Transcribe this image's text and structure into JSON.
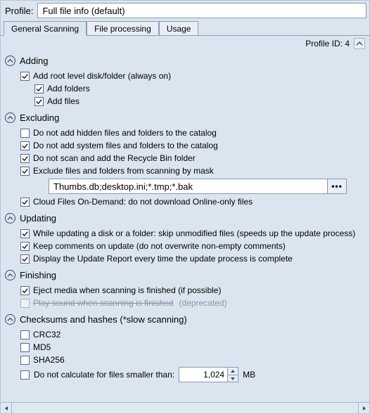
{
  "profile": {
    "label": "Profile:",
    "value": "Full file info (default)"
  },
  "tabs": [
    {
      "label": "General Scanning",
      "active": true
    },
    {
      "label": "File processing",
      "active": false
    },
    {
      "label": "Usage",
      "active": false
    }
  ],
  "meta": {
    "profile_id_label": "Profile ID: 4"
  },
  "sections": {
    "adding": {
      "title": "Adding",
      "items": {
        "root": "Add root level disk/folder (always on)",
        "folders": "Add folders",
        "files": "Add files"
      }
    },
    "excluding": {
      "title": "Excluding",
      "items": {
        "hidden": "Do not add hidden files and folders to the catalog",
        "system": "Do not add system files and folders to the catalog",
        "recycle": "Do not scan and add the Recycle Bin folder",
        "mask": "Exclude files and folders from scanning by mask",
        "mask_value": "Thumbs.db;desktop.ini;*.tmp;*.bak",
        "mask_btn": "•••",
        "cloud": "Cloud Files On-Demand: do not download Online-only files"
      }
    },
    "updating": {
      "title": "Updating",
      "items": {
        "skip": "While updating a disk or a folder: skip unmodified files (speeds up the update process)",
        "comments": "Keep comments on update (do not overwrite non-empty comments)",
        "report": "Display the Update Report every time the update process is complete"
      }
    },
    "finishing": {
      "title": "Finishing",
      "items": {
        "eject": "Eject media when scanning is finished (if possible)",
        "sound": "Play sound when scanning is finished",
        "deprecated": "(deprecated)"
      }
    },
    "checksums": {
      "title": "Checksums and hashes (*slow scanning)",
      "items": {
        "crc32": "CRC32",
        "md5": "MD5",
        "sha256": "SHA256",
        "min_label": "Do not calculate for files smaller than:",
        "min_value": "1,024",
        "min_unit": "MB"
      }
    }
  }
}
